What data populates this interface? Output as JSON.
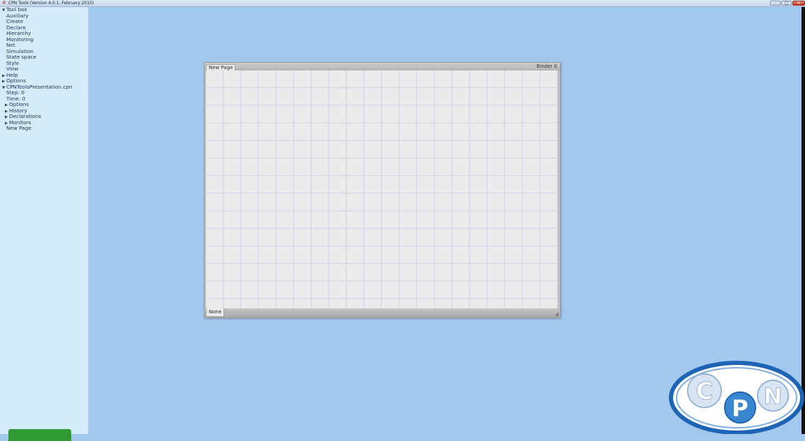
{
  "window": {
    "title": "CPN Tools (Version 4.0.1, February 2015)",
    "app_icon": "cpn-app-icon",
    "controls": {
      "minimize": "–",
      "maximize": "□",
      "close": "✕"
    }
  },
  "sidebar": {
    "nodes": [
      {
        "label": "Tool box",
        "arrow": "▼",
        "level": 0
      },
      {
        "label": "Auxiliary",
        "arrow": "",
        "level": 1
      },
      {
        "label": "Create",
        "arrow": "",
        "level": 1
      },
      {
        "label": "Declare",
        "arrow": "",
        "level": 1
      },
      {
        "label": "Hierarchy",
        "arrow": "",
        "level": 1
      },
      {
        "label": "Monitoring",
        "arrow": "",
        "level": 1
      },
      {
        "label": "Net",
        "arrow": "",
        "level": 1
      },
      {
        "label": "Simulation",
        "arrow": "",
        "level": 1
      },
      {
        "label": "State space",
        "arrow": "",
        "level": 1
      },
      {
        "label": "Style",
        "arrow": "",
        "level": 1
      },
      {
        "label": "View",
        "arrow": "",
        "level": 1
      },
      {
        "label": "Help",
        "arrow": "▶",
        "level": 0
      },
      {
        "label": "Options",
        "arrow": "▶",
        "level": 0
      },
      {
        "label": "CPNToolsPresentation.cpn",
        "arrow": "▼",
        "level": 0
      },
      {
        "label": "Step: 0",
        "arrow": "",
        "level": 1
      },
      {
        "label": "Time: 0",
        "arrow": "",
        "level": 1
      },
      {
        "label": "Options",
        "arrow": "▶",
        "level": 0,
        "indent": 1
      },
      {
        "label": "History",
        "arrow": "▶",
        "level": 0,
        "indent": 1
      },
      {
        "label": "Declarations",
        "arrow": "▶",
        "level": 0,
        "indent": 1
      },
      {
        "label": "Monitors",
        "arrow": "▶",
        "level": 0,
        "indent": 1
      },
      {
        "label": "New Page",
        "arrow": "",
        "level": 1
      }
    ],
    "status_color": "#2f9a33"
  },
  "binder": {
    "tab_label": "New Page",
    "binder_label": "Binder 0",
    "bottom_label": "None"
  },
  "logo": {
    "letters": [
      "C",
      "P",
      "N"
    ],
    "colors": {
      "ring": "#1e64b4",
      "accent": "#3a86d0"
    }
  }
}
